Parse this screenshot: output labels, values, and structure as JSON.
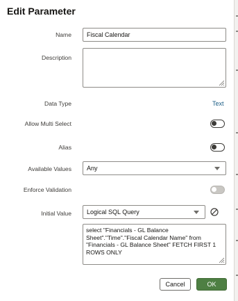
{
  "dialog": {
    "title": "Edit Parameter"
  },
  "fields": {
    "name": {
      "label": "Name",
      "value": "Fiscal Calendar"
    },
    "description": {
      "label": "Description",
      "value": ""
    },
    "data_type": {
      "label": "Data Type",
      "value": "Text"
    },
    "allow_multi_select": {
      "label": "Allow Multi Select",
      "checked": false
    },
    "alias": {
      "label": "Alias",
      "checked": false
    },
    "available_values": {
      "label": "Available Values",
      "value": "Any"
    },
    "enforce_validation": {
      "label": "Enforce Validation",
      "checked": false,
      "disabled": true
    },
    "initial_value": {
      "label": "Initial Value",
      "value": "Logical SQL Query",
      "query": "select \"Financials - GL Balance Sheet\".\"Time\".\"Fiscal Calendar Name\" from \"Financials - GL Balance Sheet\" FETCH FIRST 1 ROWS ONLY"
    }
  },
  "actions": {
    "cancel_label": "Cancel",
    "ok_label": "OK"
  },
  "icons": {
    "dropdown": "chevron-down-icon",
    "clear": "clear-icon",
    "resize": "resize-grip-icon"
  },
  "colors": {
    "primary_button": "#4e7f43",
    "link_text": "#1c5e86"
  }
}
